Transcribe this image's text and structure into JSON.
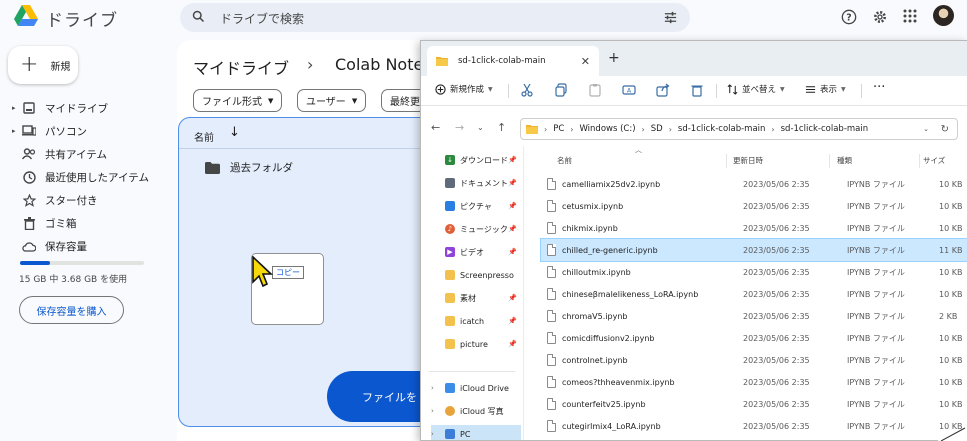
{
  "drive": {
    "app_title": "ドライブ",
    "search_placeholder": "ドライブで検索",
    "new_label": "新規",
    "nav": [
      {
        "label": "マイドライブ",
        "icon": "my-drive-icon"
      },
      {
        "label": "パソコン",
        "icon": "computer-icon"
      },
      {
        "label": "共有アイテム",
        "icon": "shared-icon"
      },
      {
        "label": "最近使用したアイテム",
        "icon": "clock-icon"
      },
      {
        "label": "スター付き",
        "icon": "star-icon"
      },
      {
        "label": "ゴミ箱",
        "icon": "trash-icon"
      },
      {
        "label": "保存容量",
        "icon": "cloud-icon"
      }
    ],
    "storage_used_fraction": 0.245,
    "storage_text": "15 GB 中 3.68 GB を使用",
    "buy_storage_label": "保存容量を購入",
    "breadcrumb": {
      "root": "マイドライブ",
      "separator": "›",
      "current": "Colab Note"
    },
    "filters": [
      "ファイル形式",
      "ユーザー",
      "最終更"
    ],
    "column_name": "名前",
    "folder_name": "過去フォルダ",
    "drag_copy_label": "コピー",
    "upload_label": "ファイルをド"
  },
  "explorer": {
    "tab_title": "sd-1click-colab-main",
    "toolbar": {
      "new": "新規作成",
      "sort": "並べ替え",
      "view": "表示",
      "more": "···"
    },
    "address": [
      "PC",
      "Windows (C:)",
      "SD",
      "sd-1click-colab-main",
      "sd-1click-colab-main"
    ],
    "quick_access": [
      {
        "label": "ダウンロード",
        "color": "#2b8a3e"
      },
      {
        "label": "ドキュメント",
        "color": "#5f6b7a"
      },
      {
        "label": "ピクチャ",
        "color": "#2a7de1"
      },
      {
        "label": "ミュージック",
        "color": "#e0603a"
      },
      {
        "label": "ビデオ",
        "color": "#8e44d6"
      },
      {
        "label": "Screenpresso",
        "color": "#f2c14e"
      },
      {
        "label": "素材",
        "color": "#f2c14e"
      },
      {
        "label": "icatch",
        "color": "#f2c14e"
      },
      {
        "label": "picture",
        "color": "#f2c14e"
      }
    ],
    "tree": [
      {
        "label": "iCloud Drive",
        "color": "#3b8ee8"
      },
      {
        "label": "iCloud 写真",
        "color": "#e8a33b"
      },
      {
        "label": "PC",
        "color": "#3b7dd8"
      }
    ],
    "columns": {
      "name": "名前",
      "date": "更新日時",
      "type": "種類",
      "size": "サイズ"
    },
    "files": [
      {
        "name": "camelliamix25dv2.ipynb",
        "date": "2023/05/06 2:35",
        "type": "IPYNB ファイル",
        "size": "10 KB"
      },
      {
        "name": "cetusmix.ipynb",
        "date": "2023/05/06 2:35",
        "type": "IPYNB ファイル",
        "size": "10 KB"
      },
      {
        "name": "chikmix.ipynb",
        "date": "2023/05/06 2:35",
        "type": "IPYNB ファイル",
        "size": "10 KB"
      },
      {
        "name": "chilled_re-generic.ipynb",
        "date": "2023/05/06 2:35",
        "type": "IPYNB ファイル",
        "size": "11 KB"
      },
      {
        "name": "chilloutmix.ipynb",
        "date": "2023/05/06 2:35",
        "type": "IPYNB ファイル",
        "size": "10 KB"
      },
      {
        "name": "chineseβmalelikeness_LoRA.ipynb",
        "date": "2023/05/06 2:35",
        "type": "IPYNB ファイル",
        "size": "10 KB"
      },
      {
        "name": "chromaV5.ipynb",
        "date": "2023/05/06 2:35",
        "type": "IPYNB ファイル",
        "size": "2 KB"
      },
      {
        "name": "comicdiffusionv2.ipynb",
        "date": "2023/05/06 2:35",
        "type": "IPYNB ファイル",
        "size": "10 KB"
      },
      {
        "name": "controlnet.ipynb",
        "date": "2023/05/06 2:35",
        "type": "IPYNB ファイル",
        "size": "10 KB"
      },
      {
        "name": "comeos?thheavenmix.ipynb",
        "date": "2023/05/06 2:35",
        "type": "IPYNB ファイル",
        "size": "10 KB"
      },
      {
        "name": "counterfeitv25.ipynb",
        "date": "2023/05/06 2:35",
        "type": "IPYNB ファイル",
        "size": "10 KB"
      },
      {
        "name": "cutegirlmix4_LoRA.ipynb",
        "date": "2023/05/06 2:35",
        "type": "IPYNB ファイル",
        "size": "10 KB"
      }
    ],
    "selected_index": 3
  }
}
